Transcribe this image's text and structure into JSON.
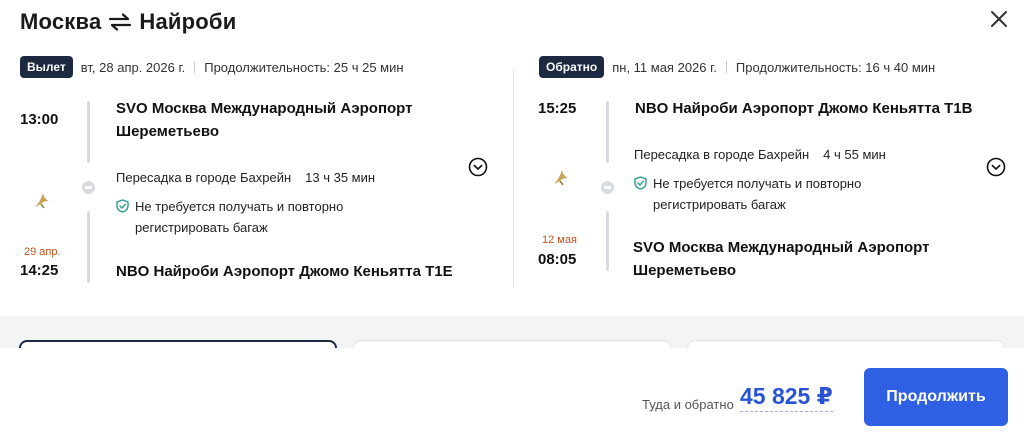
{
  "header": {
    "origin": "Москва",
    "destination": "Найроби",
    "swap_icon": "round-trip-arrows-icon",
    "close_icon": "close-icon"
  },
  "outbound": {
    "badge": "Вылет",
    "date": "вт, 28 апр. 2026 г.",
    "duration": "Продолжительность: 25 ч 25 мин",
    "depart_time": "13:00",
    "depart_station_line1": "SVO Москва Международный Аэропорт",
    "depart_station_line2": "Шереметьево",
    "transfer": "Пересадка в городе Бахрейн",
    "transfer_duration": "13 ч 35 мин",
    "baggage_line1": "Не требуется получать и повторно",
    "baggage_line2": "регистрировать багаж",
    "arrive_date": "29 апр.",
    "arrive_time": "14:25",
    "arrive_station": "NBO Найроби Аэропорт Джомо Кеньятта T1E",
    "airline_icon": "gulf-air-logo-icon"
  },
  "return": {
    "badge": "Обратно",
    "date": "пн, 11 мая 2026 г.",
    "duration": "Продолжительность: 16 ч 40 мин",
    "depart_time": "15:25",
    "depart_station": "NBO Найроби Аэропорт Джомо Кеньятта T1B",
    "transfer": "Пересадка в городе Бахрейн",
    "transfer_duration": "4 ч 55 мин",
    "baggage_line1": "Не требуется получать и повторно",
    "baggage_line2": "регистрировать багаж",
    "arrive_date": "12 мая",
    "arrive_time": "08:05",
    "arrive_station_line1": "SVO Москва Международный Аэропорт",
    "arrive_station_line2": "Шереметьево",
    "airline_icon": "gulf-air-logo-icon"
  },
  "footer": {
    "price_label": "Туда и обратно",
    "price": "45 825 ₽",
    "continue_button": "Продолжить"
  },
  "colors": {
    "badge_bg": "#1c2940",
    "accent": "#2f5fe3",
    "price": "#2b54d4",
    "arrive_date": "#c0531c"
  }
}
